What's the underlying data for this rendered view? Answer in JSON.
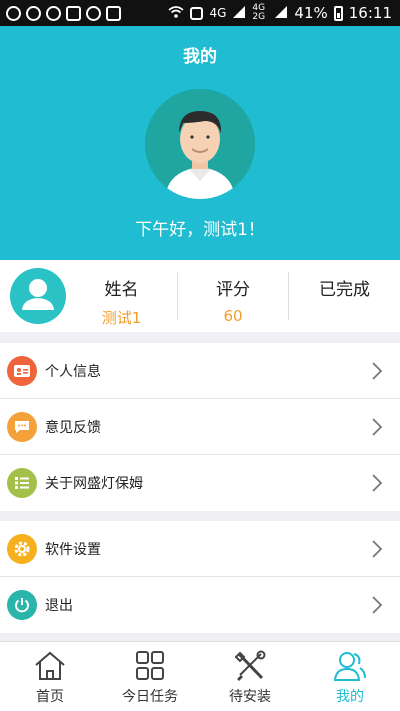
{
  "statusbar": {
    "network": "4G",
    "network2": "4G 2G",
    "battery": "41%",
    "time": "16:11"
  },
  "header": {
    "title": "我的",
    "greeting": "下午好，测试1！"
  },
  "profile": {
    "name_label": "姓名",
    "name_value": "测试1",
    "score_label": "评分",
    "score_value": "60",
    "done_label": "已完成",
    "done_value": ""
  },
  "menu_group1": [
    {
      "label": "个人信息",
      "icon": "id-card-icon",
      "color": "#f0643c"
    },
    {
      "label": "意见反馈",
      "icon": "chat-bubble-icon",
      "color": "#f5a13a"
    },
    {
      "label": "关于网盛灯保姆",
      "icon": "list-icon",
      "color": "#a3c14a"
    }
  ],
  "menu_group2": [
    {
      "label": "软件设置",
      "icon": "gear-icon",
      "color": "#f6b01e"
    },
    {
      "label": "退出",
      "icon": "power-icon",
      "color": "#2ab5aa"
    }
  ],
  "tabs": [
    {
      "label": "首页",
      "icon": "home-icon"
    },
    {
      "label": "今日任务",
      "icon": "grid-icon"
    },
    {
      "label": "待安装",
      "icon": "tools-icon"
    },
    {
      "label": "我的",
      "icon": "person-icon",
      "active": true
    }
  ],
  "colors": {
    "primary": "#1fbcd2",
    "accent": "#f39c2b"
  }
}
